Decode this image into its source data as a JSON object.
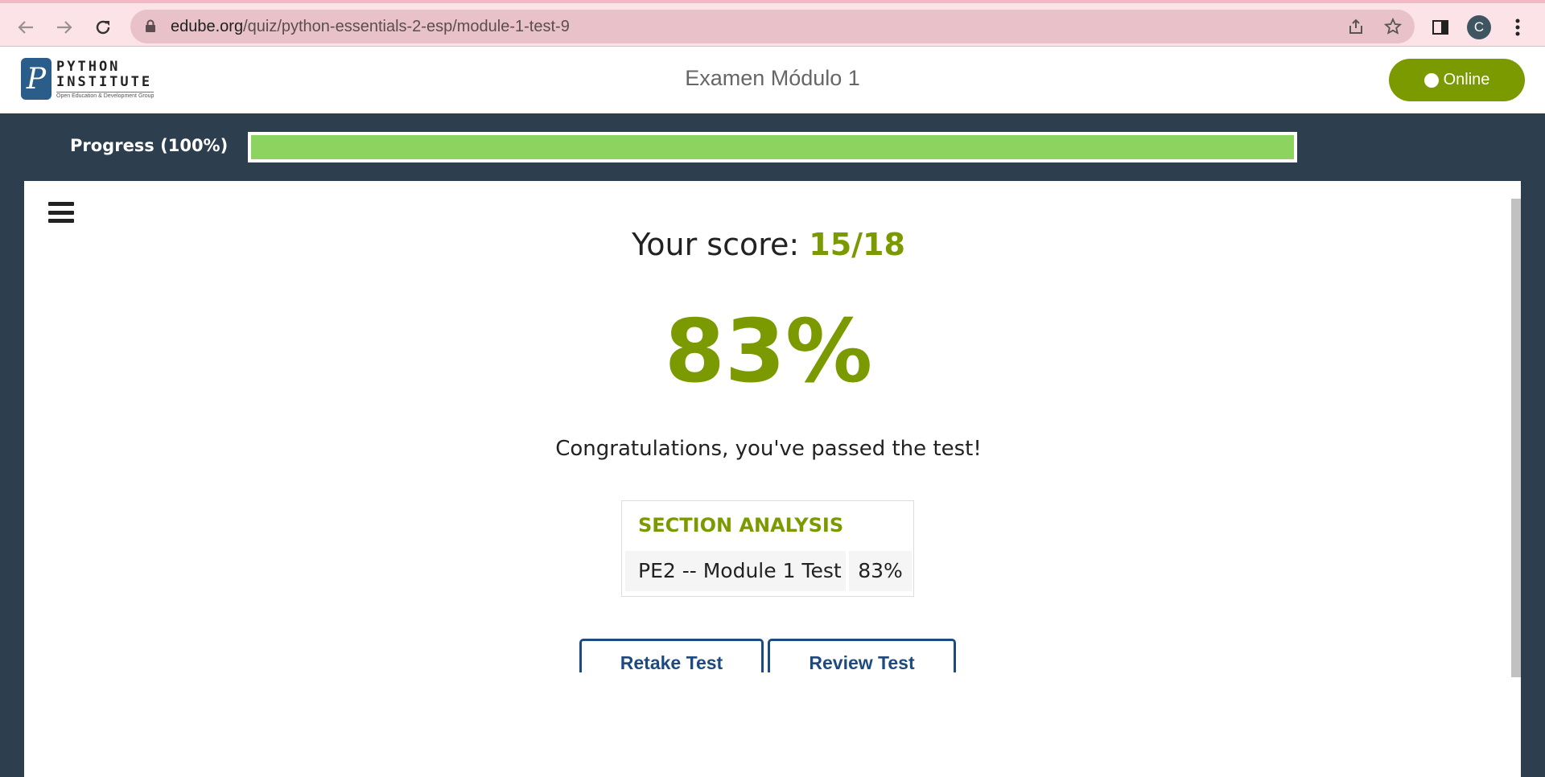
{
  "browser": {
    "url_domain": "edube.org",
    "url_path": "/quiz/python-essentials-2-esp/module-1-test-9",
    "profile_initial": "C"
  },
  "header": {
    "logo_line1": "PYTHON",
    "logo_line2": "INSTITUTE",
    "logo_tagline": "Open Education & Development Group",
    "title": "Examen Módulo 1",
    "status_label": "Online"
  },
  "progress": {
    "label": "Progress (100%)",
    "value": 1.0
  },
  "result": {
    "score_label": "Your score:",
    "score_value": "15/18",
    "percent": "83%",
    "message": "Congratulations, you've passed the test!"
  },
  "section_analysis": {
    "heading": "SECTION ANALYSIS",
    "rows": [
      {
        "name": "PE2 -- Module 1 Test",
        "value": "83%"
      }
    ]
  },
  "actions": {
    "retake_label": "Retake Test",
    "review_label": "Review Test"
  },
  "colors": {
    "accent": "#7a9a00",
    "progress_fill": "#8dd35f",
    "page_bg": "#2d3e4e",
    "button_text": "#1f4a7f"
  }
}
